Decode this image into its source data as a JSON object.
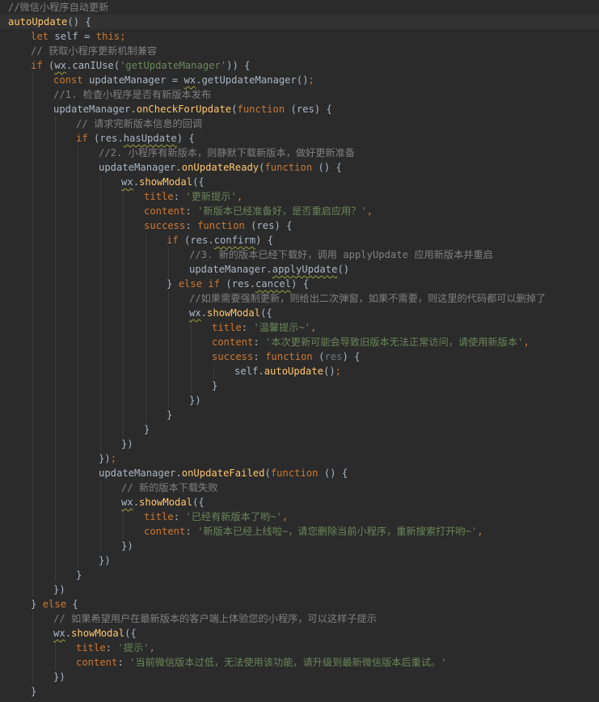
{
  "colors": {
    "background": "#2b2b2b",
    "current_line": "#323232",
    "keyword": "#cc7832",
    "string": "#6a8759",
    "comment": "#808080",
    "function": "#ffc66d",
    "plain": "#a9b7c6",
    "property": "#9876aa",
    "unused_param": "#72737a"
  },
  "lines": [
    {
      "indent": 0,
      "tokens": [
        {
          "t": "//微信小程序自动更新",
          "c": "cm"
        }
      ]
    },
    {
      "indent": 0,
      "highlight": true,
      "tokens": [
        {
          "t": "autoUpdate",
          "c": "fn"
        },
        {
          "t": "() {",
          "c": "pl"
        }
      ]
    },
    {
      "indent": 1,
      "tokens": [
        {
          "t": "let ",
          "c": "kw"
        },
        {
          "t": "self = ",
          "c": "pl"
        },
        {
          "t": "this",
          "c": "kw"
        },
        {
          "t": ";",
          "c": "kw"
        }
      ]
    },
    {
      "indent": 1,
      "tokens": [
        {
          "t": "// 获取小程序更新机制兼容",
          "c": "cm"
        }
      ]
    },
    {
      "indent": 1,
      "tokens": [
        {
          "t": "if ",
          "c": "kw"
        },
        {
          "t": "(",
          "c": "pl"
        },
        {
          "t": "wx",
          "c": "pl",
          "w": true
        },
        {
          "t": ".canIUse(",
          "c": "pl"
        },
        {
          "t": "'getUpdateManager'",
          "c": "str"
        },
        {
          "t": ")) {",
          "c": "pl"
        }
      ]
    },
    {
      "indent": 2,
      "tokens": [
        {
          "t": "const ",
          "c": "kw"
        },
        {
          "t": "updateManager = ",
          "c": "pl"
        },
        {
          "t": "wx",
          "c": "pl",
          "w": true
        },
        {
          "t": ".getUpdateManager()",
          "c": "pl"
        },
        {
          "t": ";",
          "c": "kw"
        }
      ]
    },
    {
      "indent": 2,
      "tokens": [
        {
          "t": "//1. 检查小程序是否有新版本发布",
          "c": "cm"
        }
      ]
    },
    {
      "indent": 2,
      "tokens": [
        {
          "t": "updateManager.",
          "c": "pl"
        },
        {
          "t": "onCheckForUpdate",
          "c": "fn"
        },
        {
          "t": "(",
          "c": "pl"
        },
        {
          "t": "function ",
          "c": "kw"
        },
        {
          "t": "(res) {",
          "c": "pl"
        }
      ]
    },
    {
      "indent": 3,
      "tokens": [
        {
          "t": "// 请求完新版本信息的回调",
          "c": "cm"
        }
      ]
    },
    {
      "indent": 3,
      "tokens": [
        {
          "t": "if ",
          "c": "kw"
        },
        {
          "t": "(res.",
          "c": "pl"
        },
        {
          "t": "hasUpdate",
          "c": "pl",
          "w": true
        },
        {
          "t": ") {",
          "c": "pl"
        }
      ]
    },
    {
      "indent": 4,
      "tokens": [
        {
          "t": "//2. 小程序有新版本，则静默下载新版本，做好更新准备",
          "c": "cm"
        }
      ]
    },
    {
      "indent": 4,
      "tokens": [
        {
          "t": "updateManager.",
          "c": "pl"
        },
        {
          "t": "onUpdateReady",
          "c": "fn"
        },
        {
          "t": "(",
          "c": "pl"
        },
        {
          "t": "function ",
          "c": "kw"
        },
        {
          "t": "() {",
          "c": "pl"
        }
      ]
    },
    {
      "indent": 5,
      "tokens": [
        {
          "t": "wx",
          "c": "pl",
          "w": true
        },
        {
          "t": ".",
          "c": "pl"
        },
        {
          "t": "showModal",
          "c": "fn"
        },
        {
          "t": "({",
          "c": "pl"
        }
      ]
    },
    {
      "indent": 6,
      "tokens": [
        {
          "t": "title",
          "c": "kw"
        },
        {
          "t": ": ",
          "c": "pl"
        },
        {
          "t": "'更新提示'",
          "c": "str"
        },
        {
          "t": ",",
          "c": "kw"
        }
      ]
    },
    {
      "indent": 6,
      "tokens": [
        {
          "t": "content",
          "c": "kw"
        },
        {
          "t": ": ",
          "c": "pl"
        },
        {
          "t": "'新版本已经准备好，是否重启应用？'",
          "c": "str"
        },
        {
          "t": ",",
          "c": "kw"
        }
      ]
    },
    {
      "indent": 6,
      "tokens": [
        {
          "t": "success",
          "c": "kw"
        },
        {
          "t": ": ",
          "c": "pl"
        },
        {
          "t": "function ",
          "c": "kw"
        },
        {
          "t": "(res) {",
          "c": "pl"
        }
      ]
    },
    {
      "indent": 7,
      "tokens": [
        {
          "t": "if ",
          "c": "kw"
        },
        {
          "t": "(res.",
          "c": "pl"
        },
        {
          "t": "confirm",
          "c": "pl",
          "w": true
        },
        {
          "t": ") {",
          "c": "pl"
        }
      ]
    },
    {
      "indent": 8,
      "tokens": [
        {
          "t": "//3. 新的版本已经下载好，调用 applyUpdate 应用新版本并重启",
          "c": "cm"
        }
      ]
    },
    {
      "indent": 8,
      "tokens": [
        {
          "t": "updateManager.",
          "c": "pl"
        },
        {
          "t": "applyUpdate",
          "c": "pl",
          "w": true
        },
        {
          "t": "()",
          "c": "pl"
        }
      ]
    },
    {
      "indent": 7,
      "tokens": [
        {
          "t": "} ",
          "c": "pl"
        },
        {
          "t": "else if ",
          "c": "kw"
        },
        {
          "t": "(res.",
          "c": "pl"
        },
        {
          "t": "cancel",
          "c": "pl",
          "w": true
        },
        {
          "t": ") {",
          "c": "pl"
        }
      ]
    },
    {
      "indent": 8,
      "tokens": [
        {
          "t": "//如果需要强制更新，则给出二次弹窗，如果不需要，则这里的代码都可以删掉了",
          "c": "cm"
        }
      ]
    },
    {
      "indent": 8,
      "tokens": [
        {
          "t": "wx",
          "c": "pl",
          "w": true
        },
        {
          "t": ".",
          "c": "pl"
        },
        {
          "t": "showModal",
          "c": "fn"
        },
        {
          "t": "({",
          "c": "pl"
        }
      ]
    },
    {
      "indent": 9,
      "tokens": [
        {
          "t": "title",
          "c": "kw"
        },
        {
          "t": ": ",
          "c": "pl"
        },
        {
          "t": "'温馨提示~'",
          "c": "str"
        },
        {
          "t": ",",
          "c": "kw"
        }
      ]
    },
    {
      "indent": 9,
      "tokens": [
        {
          "t": "content",
          "c": "kw"
        },
        {
          "t": ": ",
          "c": "pl"
        },
        {
          "t": "'本次更新可能会导致旧版本无法正常访问，请使用新版本'",
          "c": "str"
        },
        {
          "t": ",",
          "c": "kw"
        }
      ]
    },
    {
      "indent": 9,
      "tokens": [
        {
          "t": "success",
          "c": "kw"
        },
        {
          "t": ": ",
          "c": "pl"
        },
        {
          "t": "function ",
          "c": "kw"
        },
        {
          "t": "(",
          "c": "pl"
        },
        {
          "t": "res",
          "c": "dim"
        },
        {
          "t": ") {",
          "c": "pl"
        }
      ]
    },
    {
      "indent": 10,
      "tokens": [
        {
          "t": "self.",
          "c": "pl"
        },
        {
          "t": "autoUpdate",
          "c": "fn"
        },
        {
          "t": "()",
          "c": "pl"
        },
        {
          "t": ";",
          "c": "kw"
        }
      ]
    },
    {
      "indent": 9,
      "tokens": [
        {
          "t": "}",
          "c": "pl"
        }
      ]
    },
    {
      "indent": 8,
      "tokens": [
        {
          "t": "})",
          "c": "pl"
        }
      ]
    },
    {
      "indent": 7,
      "tokens": [
        {
          "t": "}",
          "c": "pl"
        }
      ]
    },
    {
      "indent": 6,
      "tokens": [
        {
          "t": "}",
          "c": "pl"
        }
      ]
    },
    {
      "indent": 5,
      "tokens": [
        {
          "t": "})",
          "c": "pl"
        }
      ]
    },
    {
      "indent": 4,
      "tokens": [
        {
          "t": "})",
          "c": "pl"
        },
        {
          "t": ";",
          "c": "kw"
        }
      ]
    },
    {
      "indent": 4,
      "tokens": [
        {
          "t": "updateManager.",
          "c": "pl"
        },
        {
          "t": "onUpdateFailed",
          "c": "fn"
        },
        {
          "t": "(",
          "c": "pl"
        },
        {
          "t": "function ",
          "c": "kw"
        },
        {
          "t": "() {",
          "c": "pl"
        }
      ]
    },
    {
      "indent": 5,
      "tokens": [
        {
          "t": "// 新的版本下载失败",
          "c": "cm"
        }
      ]
    },
    {
      "indent": 5,
      "tokens": [
        {
          "t": "wx",
          "c": "pl",
          "w": true
        },
        {
          "t": ".",
          "c": "pl"
        },
        {
          "t": "showModal",
          "c": "fn"
        },
        {
          "t": "({",
          "c": "pl"
        }
      ]
    },
    {
      "indent": 6,
      "tokens": [
        {
          "t": "title",
          "c": "kw"
        },
        {
          "t": ": ",
          "c": "pl"
        },
        {
          "t": "'已经有新版本了哟~'",
          "c": "str"
        },
        {
          "t": ",",
          "c": "kw"
        }
      ]
    },
    {
      "indent": 6,
      "tokens": [
        {
          "t": "content",
          "c": "kw"
        },
        {
          "t": ": ",
          "c": "pl"
        },
        {
          "t": "'新版本已经上线啦~，请您删除当前小程序，重新搜索打开哟~'",
          "c": "str"
        },
        {
          "t": ",",
          "c": "kw"
        }
      ]
    },
    {
      "indent": 5,
      "tokens": [
        {
          "t": "})",
          "c": "pl"
        }
      ]
    },
    {
      "indent": 4,
      "tokens": [
        {
          "t": "})",
          "c": "pl"
        }
      ]
    },
    {
      "indent": 3,
      "tokens": [
        {
          "t": "}",
          "c": "pl"
        }
      ]
    },
    {
      "indent": 2,
      "tokens": [
        {
          "t": "})",
          "c": "pl"
        }
      ]
    },
    {
      "indent": 1,
      "tokens": [
        {
          "t": "} ",
          "c": "pl"
        },
        {
          "t": "else ",
          "c": "kw"
        },
        {
          "t": "{",
          "c": "pl"
        }
      ]
    },
    {
      "indent": 2,
      "tokens": [
        {
          "t": "// 如果希望用户在最新版本的客户端上体验您的小程序，可以这样子提示",
          "c": "cm"
        }
      ]
    },
    {
      "indent": 2,
      "tokens": [
        {
          "t": "wx",
          "c": "pl",
          "w": true
        },
        {
          "t": ".",
          "c": "pl"
        },
        {
          "t": "showModal",
          "c": "fn"
        },
        {
          "t": "({",
          "c": "pl"
        }
      ]
    },
    {
      "indent": 3,
      "tokens": [
        {
          "t": "title",
          "c": "kw"
        },
        {
          "t": ": ",
          "c": "pl"
        },
        {
          "t": "'提示'",
          "c": "str"
        },
        {
          "t": ",",
          "c": "kw"
        }
      ]
    },
    {
      "indent": 3,
      "tokens": [
        {
          "t": "content",
          "c": "kw"
        },
        {
          "t": ": ",
          "c": "pl"
        },
        {
          "t": "'当前微信版本过低，无法使用该功能，请升级到最新微信版本后重试。'",
          "c": "str"
        }
      ]
    },
    {
      "indent": 2,
      "tokens": [
        {
          "t": "})",
          "c": "pl"
        }
      ]
    },
    {
      "indent": 1,
      "tokens": [
        {
          "t": "}",
          "c": "pl"
        }
      ]
    }
  ]
}
